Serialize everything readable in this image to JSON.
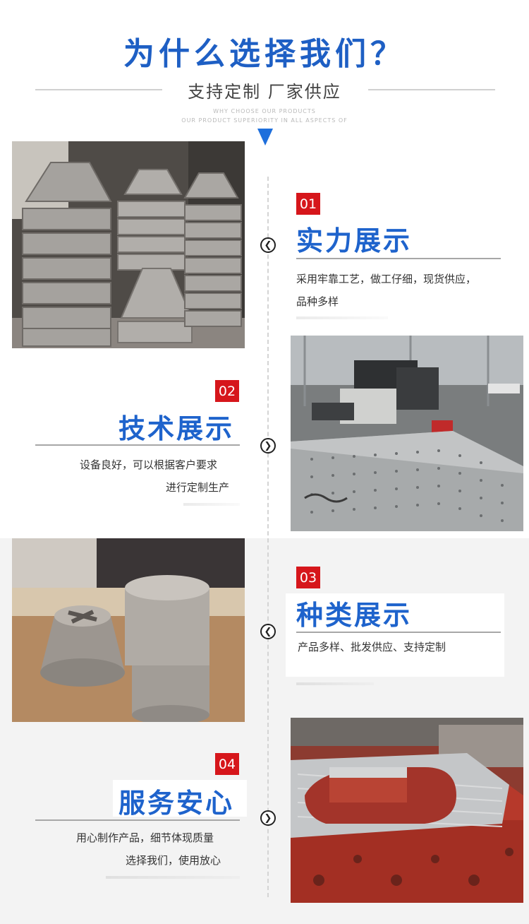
{
  "header": {
    "title": "为什么选择我们？",
    "subtitle": "支持定制 厂家供应",
    "en_line1": "WHY CHOOSE OUR PRODUCTS",
    "en_line2": "OUR PRODUCT SUPERIORITY IN ALL ASPECTS OF"
  },
  "sections": [
    {
      "num": "01",
      "heading": "实力展示",
      "desc1": "采用牢靠工艺，做工仔细，现货供应，",
      "desc2": "品种多样"
    },
    {
      "num": "02",
      "heading": "技术展示",
      "desc1": "设备良好，可以根据客户要求",
      "desc2": "进行定制生产"
    },
    {
      "num": "03",
      "heading": "种类展示",
      "desc1": "产品多样、批发供应、支持定制",
      "desc2": ""
    },
    {
      "num": "04",
      "heading": "服务安心",
      "desc1": "用心制作产品，细节体现质量",
      "desc2": "选择我们，使用放心"
    }
  ],
  "icons": {
    "arrow_left": "chevron-left-icon",
    "arrow_right": "chevron-right-icon",
    "arrow_glyph_left": "❮",
    "arrow_glyph_right": "❯"
  },
  "colors": {
    "title_blue": "#1e5fc4",
    "heading_blue": "#1e63cc",
    "badge_red": "#d6161b",
    "arrow_blue": "#1e6fdc"
  }
}
